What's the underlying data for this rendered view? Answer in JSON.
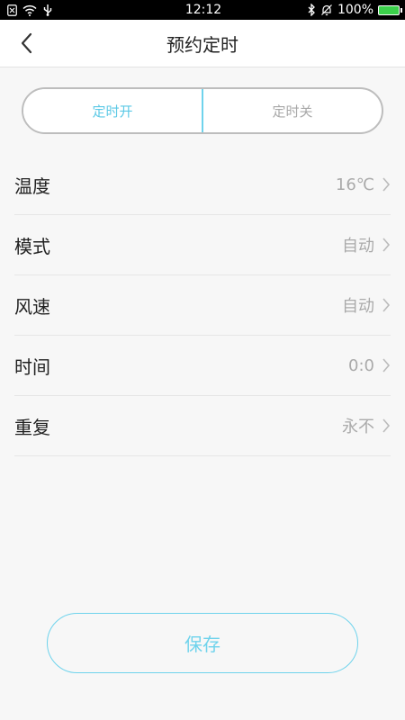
{
  "status_bar": {
    "time": "12:12",
    "battery_percent": "100%",
    "icons_left": [
      "notification-icon",
      "wifi-icon",
      "usb-icon"
    ],
    "icons_right": [
      "bluetooth-icon",
      "mute-bell-icon",
      "battery-icon"
    ]
  },
  "header": {
    "title": "预约定时"
  },
  "segment": {
    "tabs": [
      "定时开",
      "定时关"
    ],
    "active_index": 0
  },
  "settings": {
    "rows": [
      {
        "label": "温度",
        "value": "16℃"
      },
      {
        "label": "模式",
        "value": "自动"
      },
      {
        "label": "风速",
        "value": "自动"
      },
      {
        "label": "时间",
        "value": "0:0"
      },
      {
        "label": "重复",
        "value": "永不"
      }
    ]
  },
  "save_label": "保存",
  "colors": {
    "accent": "#6fd3ec",
    "battery": "#3bd14b"
  }
}
